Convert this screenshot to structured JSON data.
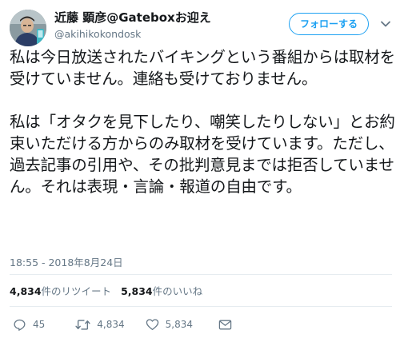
{
  "author": {
    "display_name": "近藤 顕彦@Gateboxお迎え",
    "handle": "@akihikokondosk"
  },
  "follow_button_label": "フォローする",
  "tweet_paragraphs": [
    "私は今日放送されたバイキングという番組からは取材を受けていません。連絡も受けておりません。",
    "私は「オタクを見下したり、嘲笑したりしない」とお約束いただける方からのみ取材を受けています。ただし、過去記事の引用や、その批判意見までは拒否していません。それは表現・言論・報道の自由です。"
  ],
  "timestamp": "18:55 - 2018年8月24日",
  "stats": {
    "retweets_count": "4,834",
    "retweets_label": "件のリツイート",
    "likes_count": "5,834",
    "likes_label": "件のいいね"
  },
  "actions": {
    "reply_count": "45",
    "retweet_count": "4,834",
    "like_count": "5,834"
  },
  "icons": [
    "avatar",
    "chevron-down-icon",
    "reply-icon",
    "retweet-icon",
    "like-icon",
    "direct-message-icon"
  ],
  "colors": {
    "accent": "#1da1f2",
    "text": "#14171a",
    "secondary_text": "#657786",
    "divider": "#e6ecf0"
  }
}
